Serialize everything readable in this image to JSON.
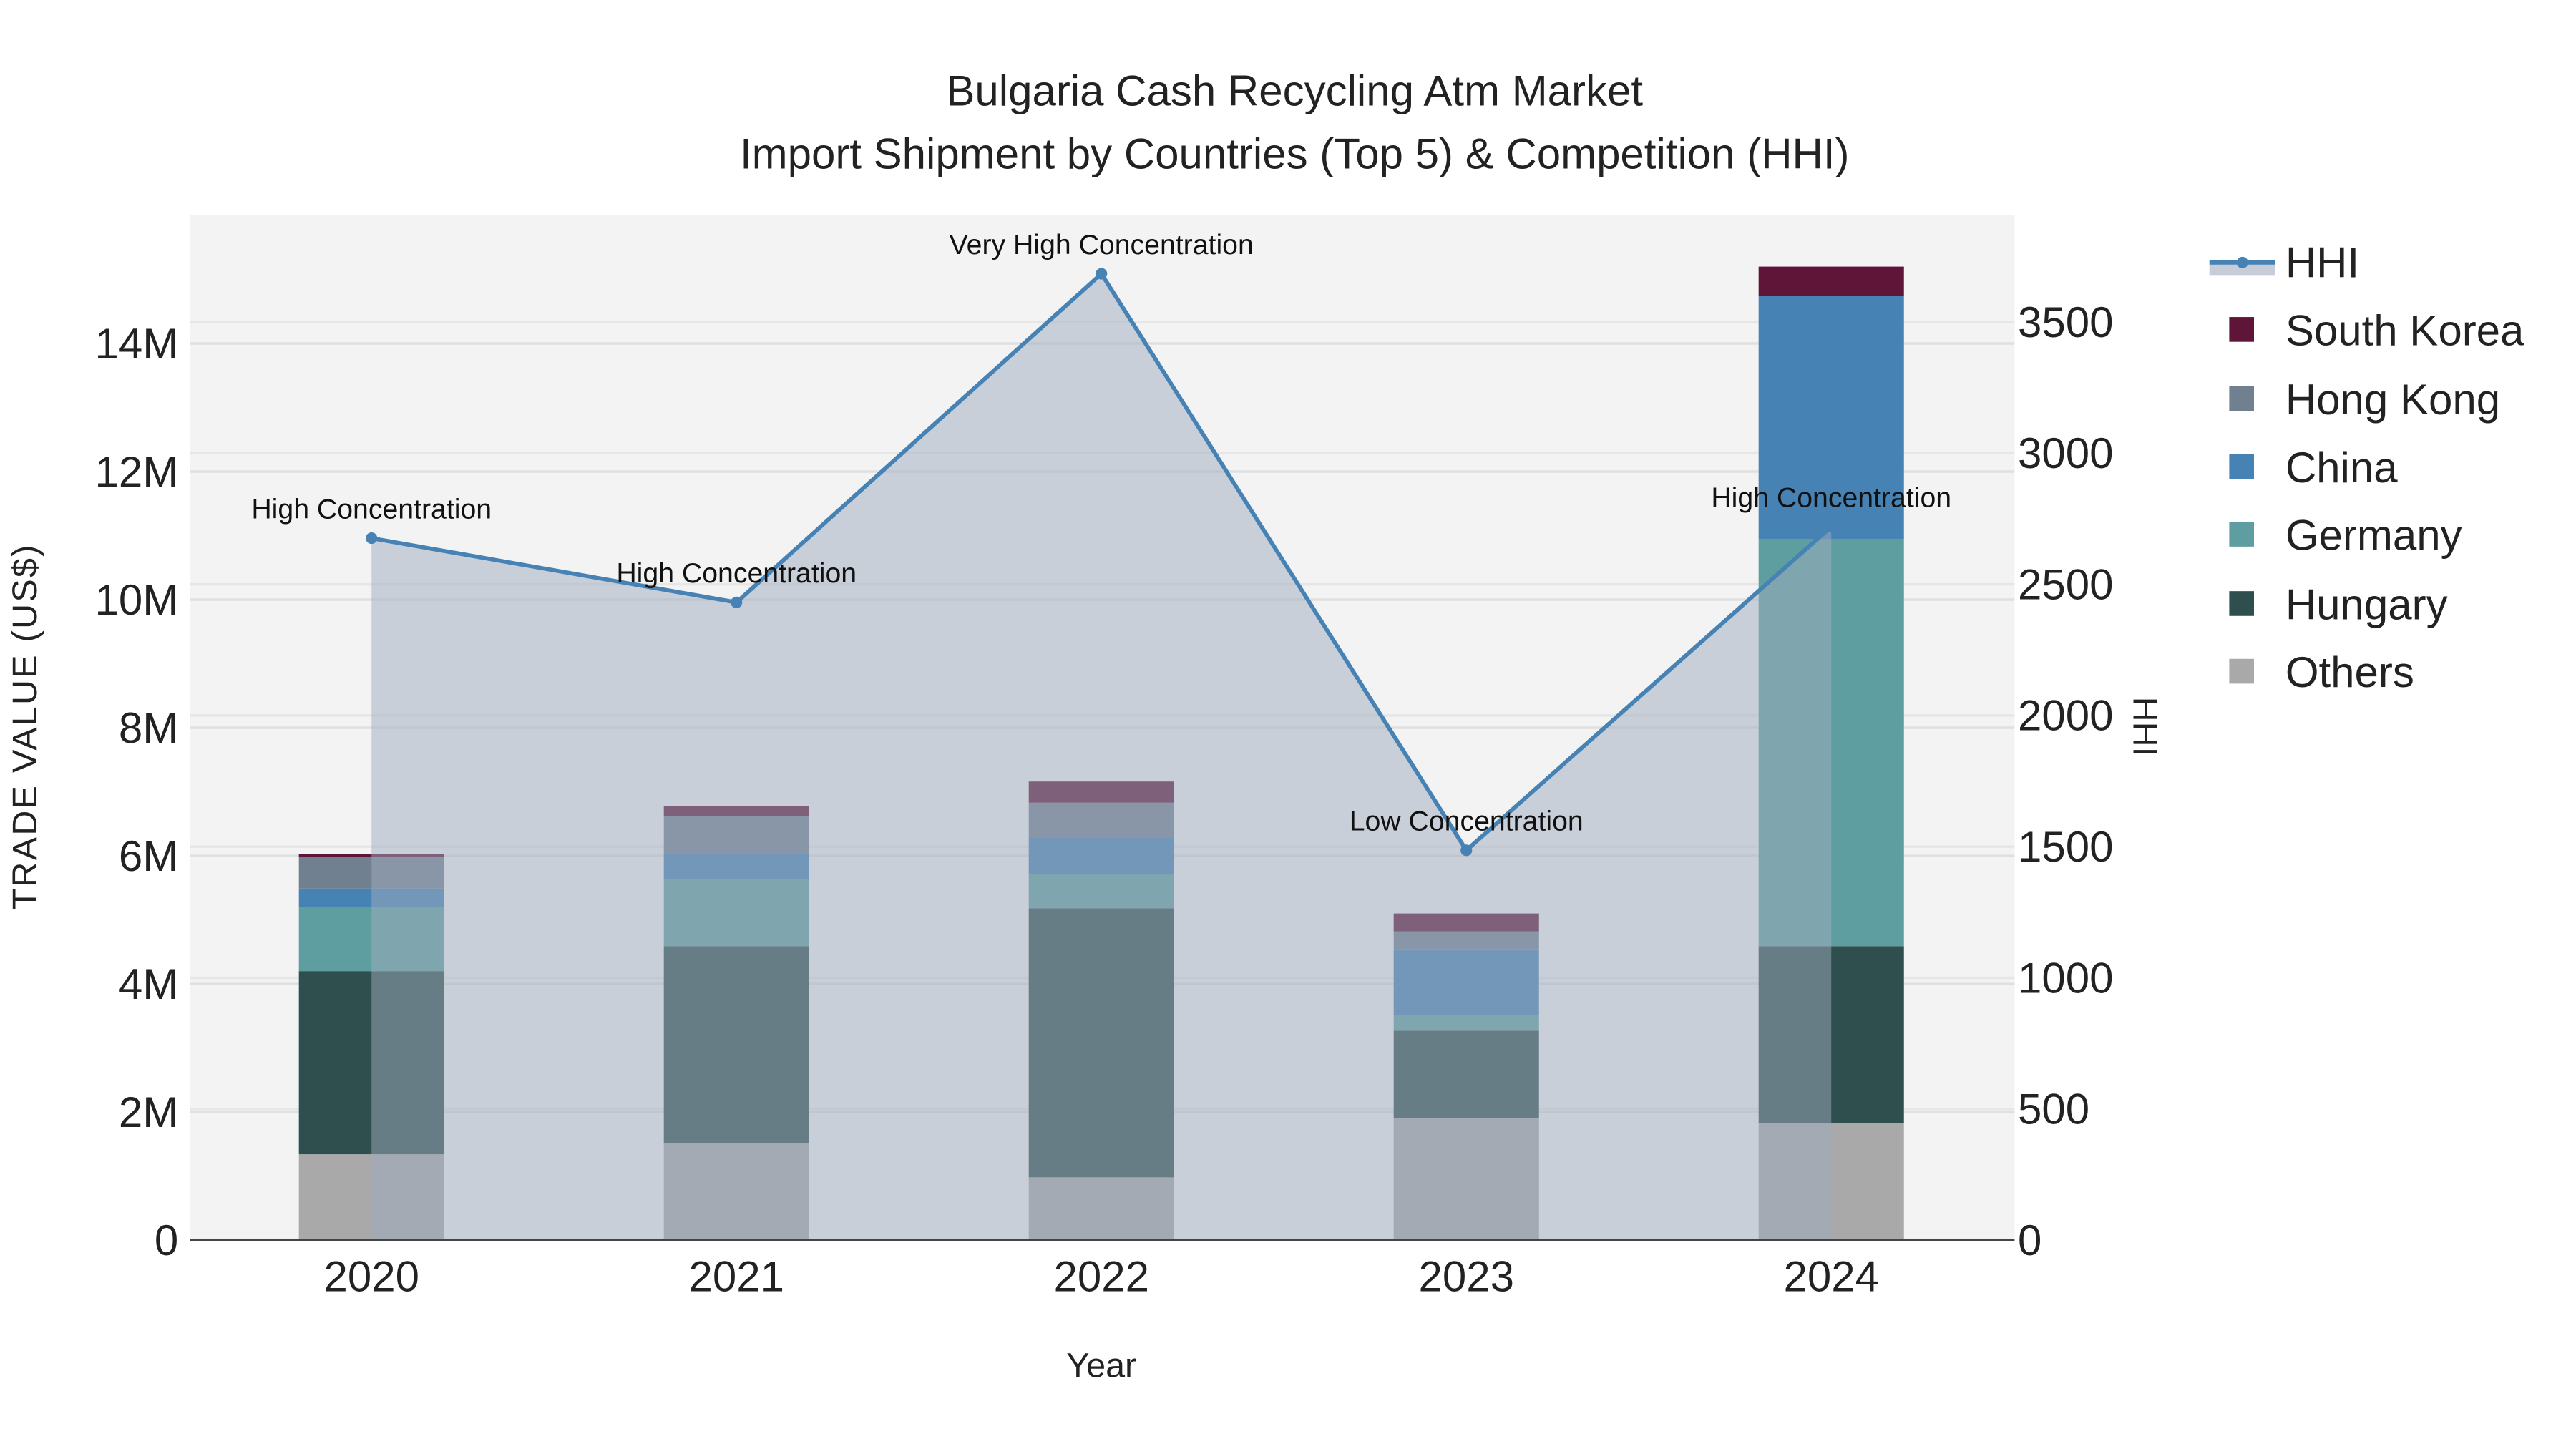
{
  "chart_data": {
    "type": "bar",
    "title": "Bulgaria Cash Recycling Atm Market",
    "subtitle": "Import Shipment by Countries (Top 5) & Competition (HHI)",
    "xlabel": "Year",
    "ylabel": "TRADE VALUE (US$)",
    "y2label": "HHI",
    "categories": [
      "2020",
      "2021",
      "2022",
      "2023",
      "2024"
    ],
    "ylim": [
      0,
      15900000
    ],
    "y2lim": [
      0,
      3900
    ],
    "yticks": [
      0,
      2000000,
      4000000,
      6000000,
      8000000,
      10000000,
      12000000,
      14000000
    ],
    "ytick_labels": [
      "0",
      "2M",
      "4M",
      "6M",
      "8M",
      "10M",
      "12M",
      "14M"
    ],
    "y2ticks": [
      0,
      500,
      1000,
      1500,
      2000,
      2500,
      3000,
      3500
    ],
    "y2tick_labels": [
      "0",
      "500",
      "1000",
      "1500",
      "2000",
      "2500",
      "3000",
      "3500"
    ],
    "grid": true,
    "legend_placement": "right",
    "stacked": true,
    "series": [
      {
        "name": "Others",
        "color": "#a9a9a9",
        "values": [
          1340000,
          1520000,
          980000,
          1910000,
          1830000
        ]
      },
      {
        "name": "Hungary",
        "color": "#2f4f4f",
        "values": [
          2860000,
          3070000,
          4200000,
          1360000,
          2760000
        ]
      },
      {
        "name": "Germany",
        "color": "#5f9ea0",
        "values": [
          1000000,
          1050000,
          540000,
          240000,
          6360000
        ]
      },
      {
        "name": "China",
        "color": "#4682b4",
        "values": [
          290000,
          390000,
          570000,
          1030000,
          3790000
        ]
      },
      {
        "name": "Hong Kong",
        "color": "#708090",
        "values": [
          490000,
          590000,
          540000,
          280000,
          0
        ]
      },
      {
        "name": "South Korea",
        "color": "#5f1537",
        "values": [
          50000,
          160000,
          330000,
          280000,
          460000
        ]
      }
    ],
    "hhi": {
      "name": "HHI",
      "color": "#4682b4",
      "values": [
        2676,
        2431,
        3684,
        1486,
        2720
      ],
      "annotations": [
        "High Concentration",
        "High Concentration",
        "Very High Concentration",
        "Low Concentration",
        "High Concentration"
      ]
    },
    "legend_order": [
      "HHI",
      "South Korea",
      "Hong Kong",
      "China",
      "Germany",
      "Hungary",
      "Others"
    ]
  }
}
